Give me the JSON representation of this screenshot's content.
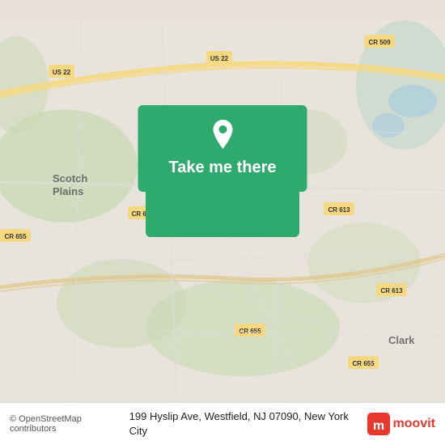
{
  "map": {
    "alt": "Map showing Westfield NJ area",
    "background_color": "#e8e0d8"
  },
  "cta": {
    "button_label": "Take me there",
    "pin_icon": "location-pin-icon"
  },
  "bottom_bar": {
    "osm_text": "© OpenStreetMap contributors",
    "address": "199 Hyslip Ave, Westfield, NJ 07090, New York City",
    "moovit_label": "moovit"
  }
}
